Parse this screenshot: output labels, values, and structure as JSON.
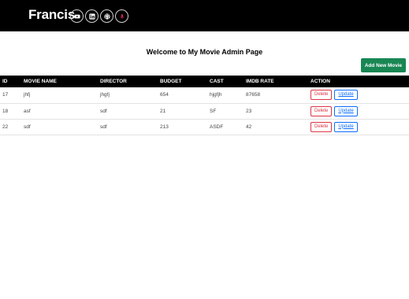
{
  "navbar": {
    "brand": "Francis",
    "icons": [
      "youtube-icon",
      "linkedin-icon",
      "github-icon",
      "microphone-icon"
    ]
  },
  "page": {
    "title": "Welcome to My Movie Admin Page",
    "add_button": "Add New Movie"
  },
  "table": {
    "headers": [
      "ID",
      "MOVIE NAME",
      "DIRECTOR",
      "BUDGET",
      "CAST",
      "IMDB RATE",
      "ACTION"
    ],
    "rows": [
      {
        "id": "17",
        "name": "jhfj",
        "director": "jhgfj",
        "budget": "654",
        "cast": "hjgfjh",
        "imdb": "87658"
      },
      {
        "id": "18",
        "name": "asf",
        "director": "sdf",
        "budget": "21",
        "cast": "SF",
        "imdb": "23"
      },
      {
        "id": "22",
        "name": "sdf",
        "director": "sdf",
        "budget": "213",
        "cast": "ASDF",
        "imdb": "42"
      }
    ],
    "delete_label": "Delete",
    "update_label": "Update"
  },
  "colors": {
    "navbar_bg": "#000000",
    "add_button_bg": "#198754",
    "delete_color": "#dc3545",
    "update_color": "#0d6efd"
  }
}
